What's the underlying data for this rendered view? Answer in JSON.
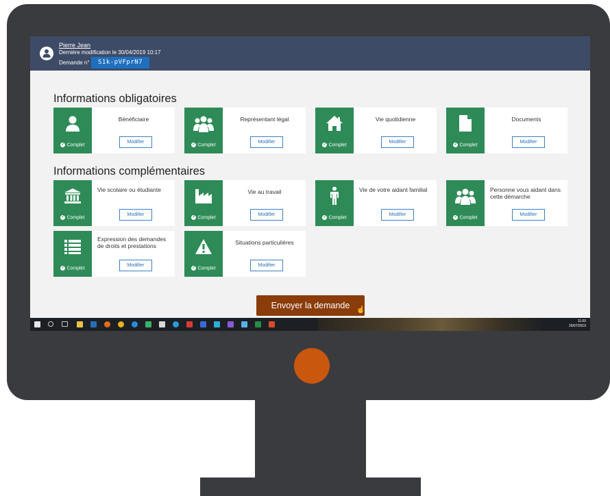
{
  "header": {
    "user_name": "Pierre Jean",
    "last_modified": "Dernière modification le 30/04/2019 10:17",
    "request_label": "Demande n°",
    "request_id": "S1k-pVFprN7"
  },
  "sections": {
    "mandatory_title": "Informations obligatoires",
    "complementary_title": "Informations complémentaires"
  },
  "status_label": "Complet",
  "modify_label": "Modifier",
  "cards": [
    {
      "label": "Bénéficiaire",
      "icon": "person-icon"
    },
    {
      "label": "Représentant légal",
      "icon": "group-icon"
    },
    {
      "label": "Vie quotidienne",
      "icon": "home-icon"
    },
    {
      "label": "Documents",
      "icon": "document-icon"
    },
    {
      "label": "Vie scolaire ou étudiante",
      "icon": "institution-icon"
    },
    {
      "label": "Vie au travail",
      "icon": "factory-icon"
    },
    {
      "label": "Vie de votre aidant familial",
      "icon": "standing-person-icon"
    },
    {
      "label": "Personne vous aidant dans cette démarche",
      "icon": "group-icon"
    },
    {
      "label": "Expression des demandes de droits et prestations",
      "icon": "list-icon"
    },
    {
      "label": "Situations particulières",
      "icon": "warning-icon"
    }
  ],
  "submit_label": "Envoyer la demande",
  "taskbar": {
    "time": "11:00",
    "date": "29/07/2019"
  },
  "colors": {
    "header_bg": "#3e4b66",
    "card_accent": "#2e8b57",
    "request_badge": "#1f6fbf",
    "submit_bg": "#8a3c0a",
    "monitor": "#3a3b3f",
    "power_dot": "#c9570d"
  }
}
